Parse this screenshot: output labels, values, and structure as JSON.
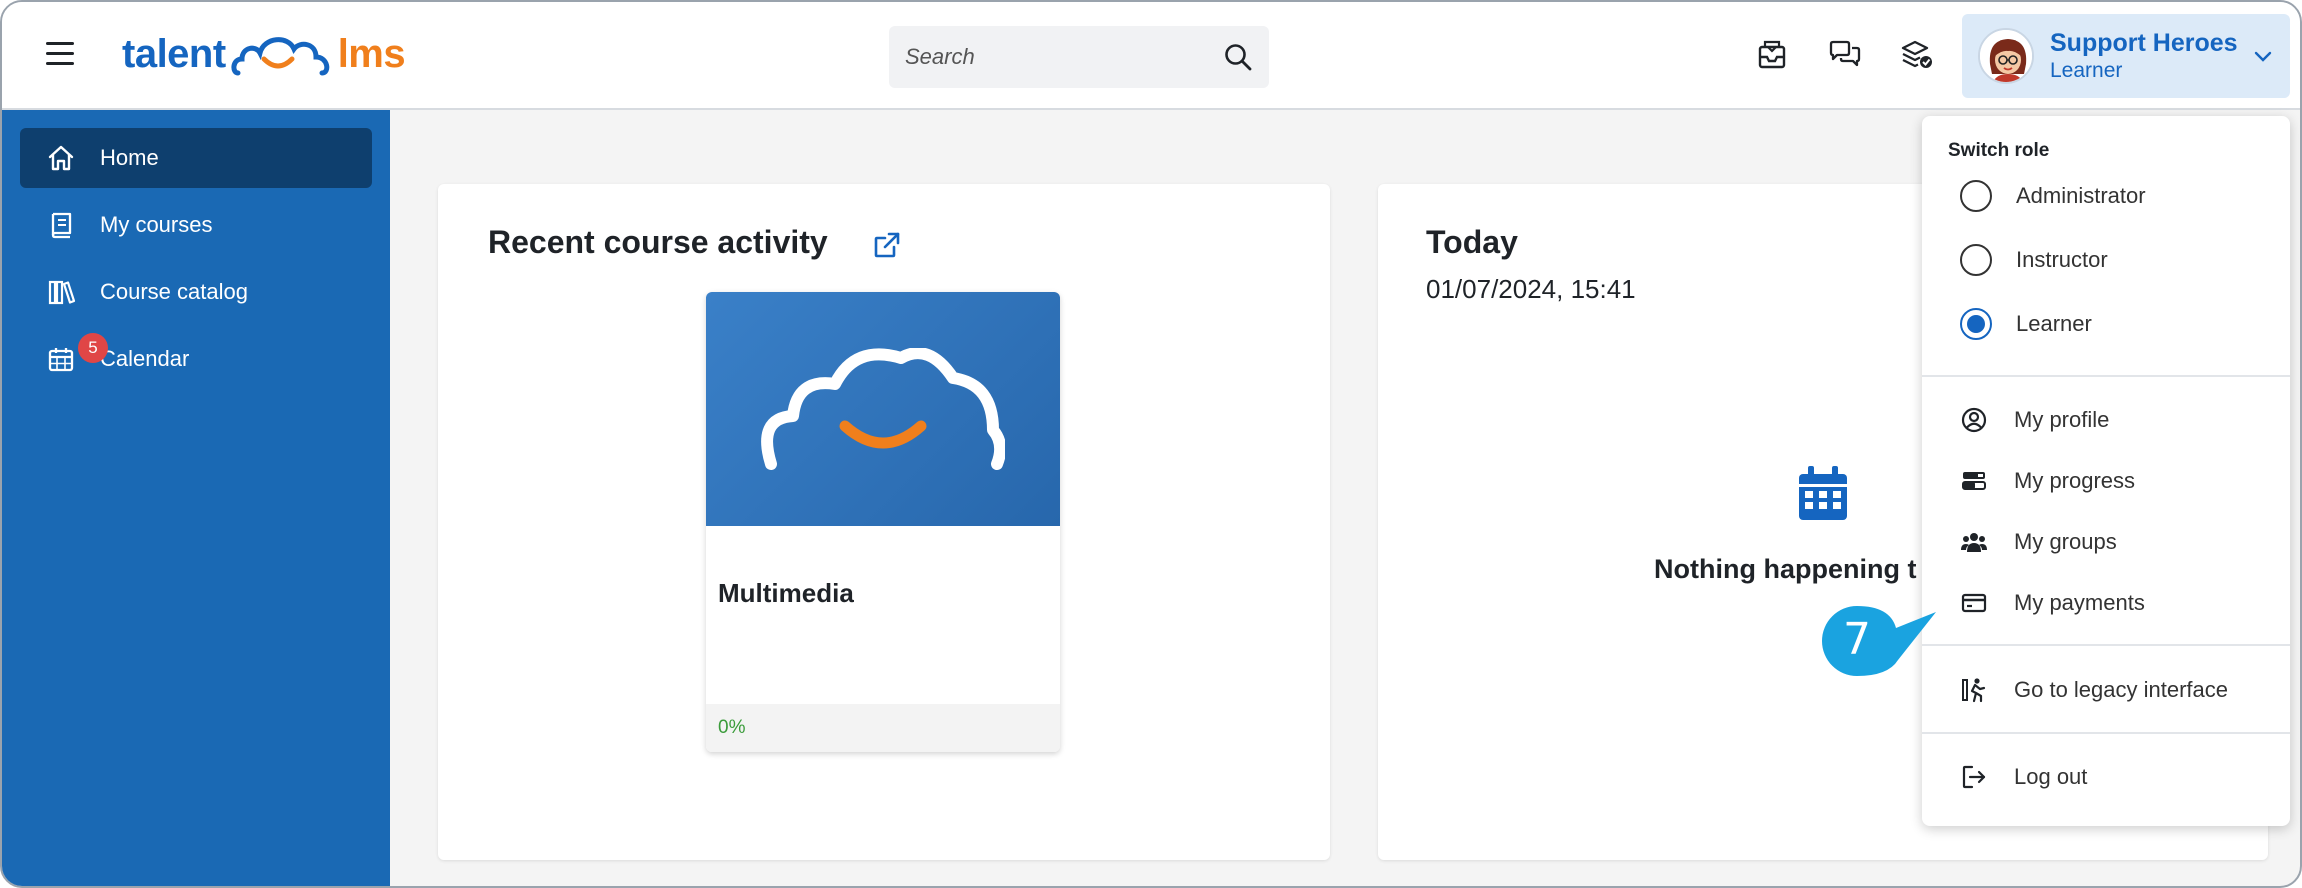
{
  "header": {
    "logo": {
      "part1": "talent",
      "part2": "lms"
    },
    "search": {
      "placeholder": "Search"
    },
    "icons": [
      "messages-icon",
      "discussions-icon",
      "courses-stack-icon"
    ],
    "user": {
      "name": "Support Heroes",
      "role": "Learner"
    }
  },
  "sidebar": {
    "items": [
      {
        "label": "Home",
        "icon": "home-icon",
        "active": true
      },
      {
        "label": "My courses",
        "icon": "book-icon"
      },
      {
        "label": "Course catalog",
        "icon": "library-icon"
      },
      {
        "label": "Calendar",
        "icon": "calendar-icon",
        "badge": "5"
      }
    ]
  },
  "recent": {
    "title": "Recent course activity",
    "course": {
      "name": "Multimedia",
      "progress": "0%"
    }
  },
  "today": {
    "title": "Today",
    "date": "01/07/2024, 15:41",
    "empty_text": "Nothing happening t"
  },
  "dropdown": {
    "heading": "Switch role",
    "roles": [
      {
        "label": "Administrator",
        "checked": false
      },
      {
        "label": "Instructor",
        "checked": false
      },
      {
        "label": "Learner",
        "checked": true
      }
    ],
    "menu": [
      {
        "label": "My profile",
        "icon": "profile-icon"
      },
      {
        "label": "My progress",
        "icon": "progress-icon"
      },
      {
        "label": "My groups",
        "icon": "groups-icon"
      },
      {
        "label": "My payments",
        "icon": "payments-icon"
      }
    ],
    "legacy": {
      "label": "Go to legacy interface",
      "icon": "legacy-icon"
    },
    "logout": {
      "label": "Log out",
      "icon": "logout-icon"
    }
  },
  "callout": {
    "number": "7",
    "color": "#1aa3e0"
  },
  "colors": {
    "brand_blue": "#1565c0",
    "sidebar": "#1a69b4",
    "sidebar_active": "#0e3f6e",
    "orange": "#f07f1c",
    "badge": "#e04646"
  }
}
